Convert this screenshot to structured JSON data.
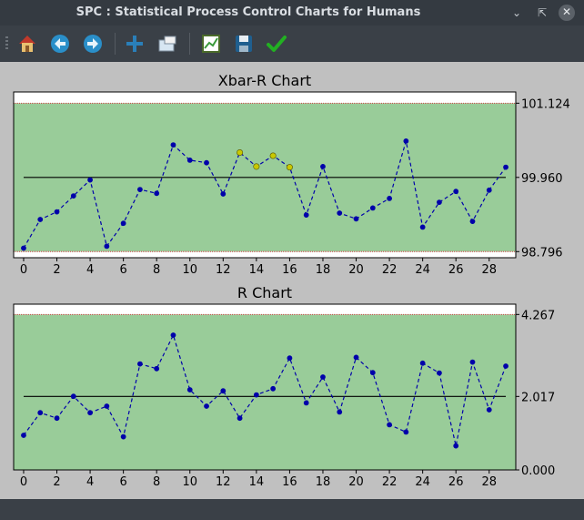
{
  "window": {
    "title": "SPC : Statistical Process Control Charts for Humans"
  },
  "toolbar": {
    "buttons": [
      "home-icon",
      "back-icon",
      "forward-icon",
      "pan-icon",
      "zoom-icon",
      "subplots-icon",
      "save-icon",
      "check-icon"
    ]
  },
  "colors": {
    "control_band": "#99cc99",
    "points": "#0000aa",
    "violations": "#c8c800",
    "center_line": "#000000",
    "limit_line": "#cc4444"
  },
  "chart_data": [
    {
      "type": "line",
      "title": "Xbar-R Chart",
      "x": [
        0,
        1,
        2,
        3,
        4,
        5,
        6,
        7,
        8,
        9,
        10,
        11,
        12,
        13,
        14,
        15,
        16,
        17,
        18,
        19,
        20,
        21,
        22,
        23,
        24,
        25,
        26,
        27,
        28,
        29
      ],
      "series": [
        {
          "values": [
            98.85,
            99.3,
            99.42,
            99.67,
            99.92,
            98.88,
            99.24,
            99.77,
            99.71,
            100.47,
            100.23,
            100.19,
            99.7,
            100.35,
            100.13,
            100.3,
            100.12,
            99.37,
            100.13,
            99.4,
            99.31,
            99.48,
            99.63,
            100.53,
            99.18,
            99.57,
            99.74,
            99.27,
            99.76,
            100.12
          ]
        }
      ],
      "violation_indices": [
        13,
        14,
        15,
        16
      ],
      "center_line": 99.96,
      "ucl": 101.124,
      "lcl": 98.796,
      "ylim": [
        98.7,
        101.3
      ],
      "xticks": [
        0,
        2,
        4,
        6,
        8,
        10,
        12,
        14,
        16,
        18,
        20,
        22,
        24,
        26,
        28
      ],
      "ytick_labels": [
        "101.124",
        "99.960",
        "98.796"
      ]
    },
    {
      "type": "line",
      "title": "R Chart",
      "x": [
        0,
        1,
        2,
        3,
        4,
        5,
        6,
        7,
        8,
        9,
        10,
        11,
        12,
        13,
        14,
        15,
        16,
        17,
        18,
        19,
        20,
        21,
        22,
        23,
        24,
        25,
        26,
        27,
        28,
        29
      ],
      "series": [
        {
          "values": [
            0.95,
            1.57,
            1.42,
            2.02,
            1.57,
            1.75,
            0.91,
            2.91,
            2.78,
            3.7,
            2.2,
            1.75,
            2.17,
            1.42,
            2.06,
            2.23,
            3.07,
            1.84,
            2.55,
            1.59,
            3.09,
            2.67,
            1.24,
            1.04,
            2.93,
            2.66,
            0.66,
            2.96,
            1.65,
            2.85
          ]
        }
      ],
      "center_line": 2.017,
      "ucl": 4.267,
      "lcl": 0.0,
      "ylim": [
        0,
        4.55
      ],
      "xticks": [
        0,
        2,
        4,
        6,
        8,
        10,
        12,
        14,
        16,
        18,
        20,
        22,
        24,
        26,
        28
      ],
      "ytick_labels": [
        "4.267",
        "2.017",
        "0.000"
      ]
    }
  ]
}
